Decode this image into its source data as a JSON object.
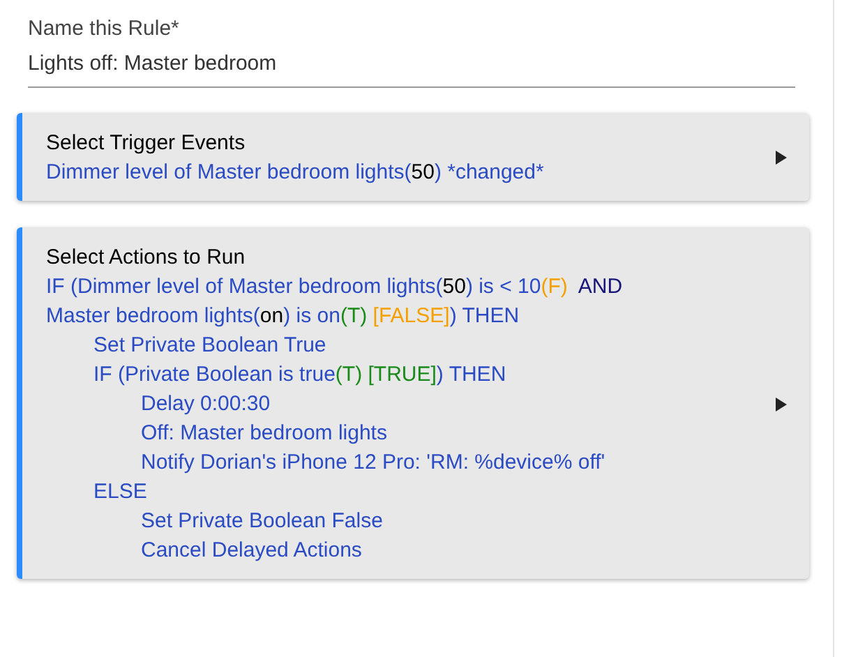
{
  "name_field": {
    "label": "Name this Rule*",
    "value": "Lights off: Master bedroom"
  },
  "sections": [
    {
      "title": "Select Trigger Events",
      "lines": [
        {
          "segments": [
            {
              "kind": "text",
              "text": "Dimmer level of Master bedroom lights("
            },
            {
              "kind": "value",
              "text": "50"
            },
            {
              "kind": "text",
              "text": ") *changed*"
            }
          ]
        }
      ]
    },
    {
      "title": "Select Actions to Run",
      "lines": [
        {
          "segments": [
            {
              "kind": "text",
              "text": "IF (Dimmer level of Master bedroom lights("
            },
            {
              "kind": "value",
              "text": "50"
            },
            {
              "kind": "text",
              "text": ") is < 10"
            },
            {
              "kind": "false",
              "text": "(F)"
            },
            {
              "kind": "operator",
              "text": "  AND"
            }
          ]
        },
        {
          "segments": [
            {
              "kind": "text",
              "text": "Master bedroom lights("
            },
            {
              "kind": "value",
              "text": "on"
            },
            {
              "kind": "text",
              "text": ") is on"
            },
            {
              "kind": "true",
              "text": "(T)"
            },
            {
              "kind": "false",
              "text": " [FALSE]"
            },
            {
              "kind": "text",
              "text": ") THEN"
            }
          ],
          "children": [
            {
              "segments": [
                {
                  "kind": "text",
                  "text": "Set Private Boolean True"
                }
              ]
            },
            {
              "segments": [
                {
                  "kind": "text",
                  "text": "IF (Private Boolean is true"
                },
                {
                  "kind": "true",
                  "text": "(T) [TRUE]"
                },
                {
                  "kind": "text",
                  "text": ") THEN"
                }
              ],
              "children": [
                {
                  "segments": [
                    {
                      "kind": "text",
                      "text": "Delay 0:00:30"
                    }
                  ]
                },
                {
                  "segments": [
                    {
                      "kind": "text",
                      "text": "Off: Master bedroom lights"
                    }
                  ]
                },
                {
                  "segments": [
                    {
                      "kind": "text",
                      "text": "Notify Dorian's iPhone 12 Pro: 'RM: %device% off'"
                    }
                  ]
                }
              ]
            },
            {
              "segments": [
                {
                  "kind": "text",
                  "text": "ELSE"
                }
              ],
              "children": [
                {
                  "segments": [
                    {
                      "kind": "text",
                      "text": "Set Private Boolean False"
                    }
                  ]
                },
                {
                  "segments": [
                    {
                      "kind": "text",
                      "text": "Cancel Delayed Actions"
                    }
                  ]
                }
              ]
            }
          ]
        }
      ]
    }
  ]
}
